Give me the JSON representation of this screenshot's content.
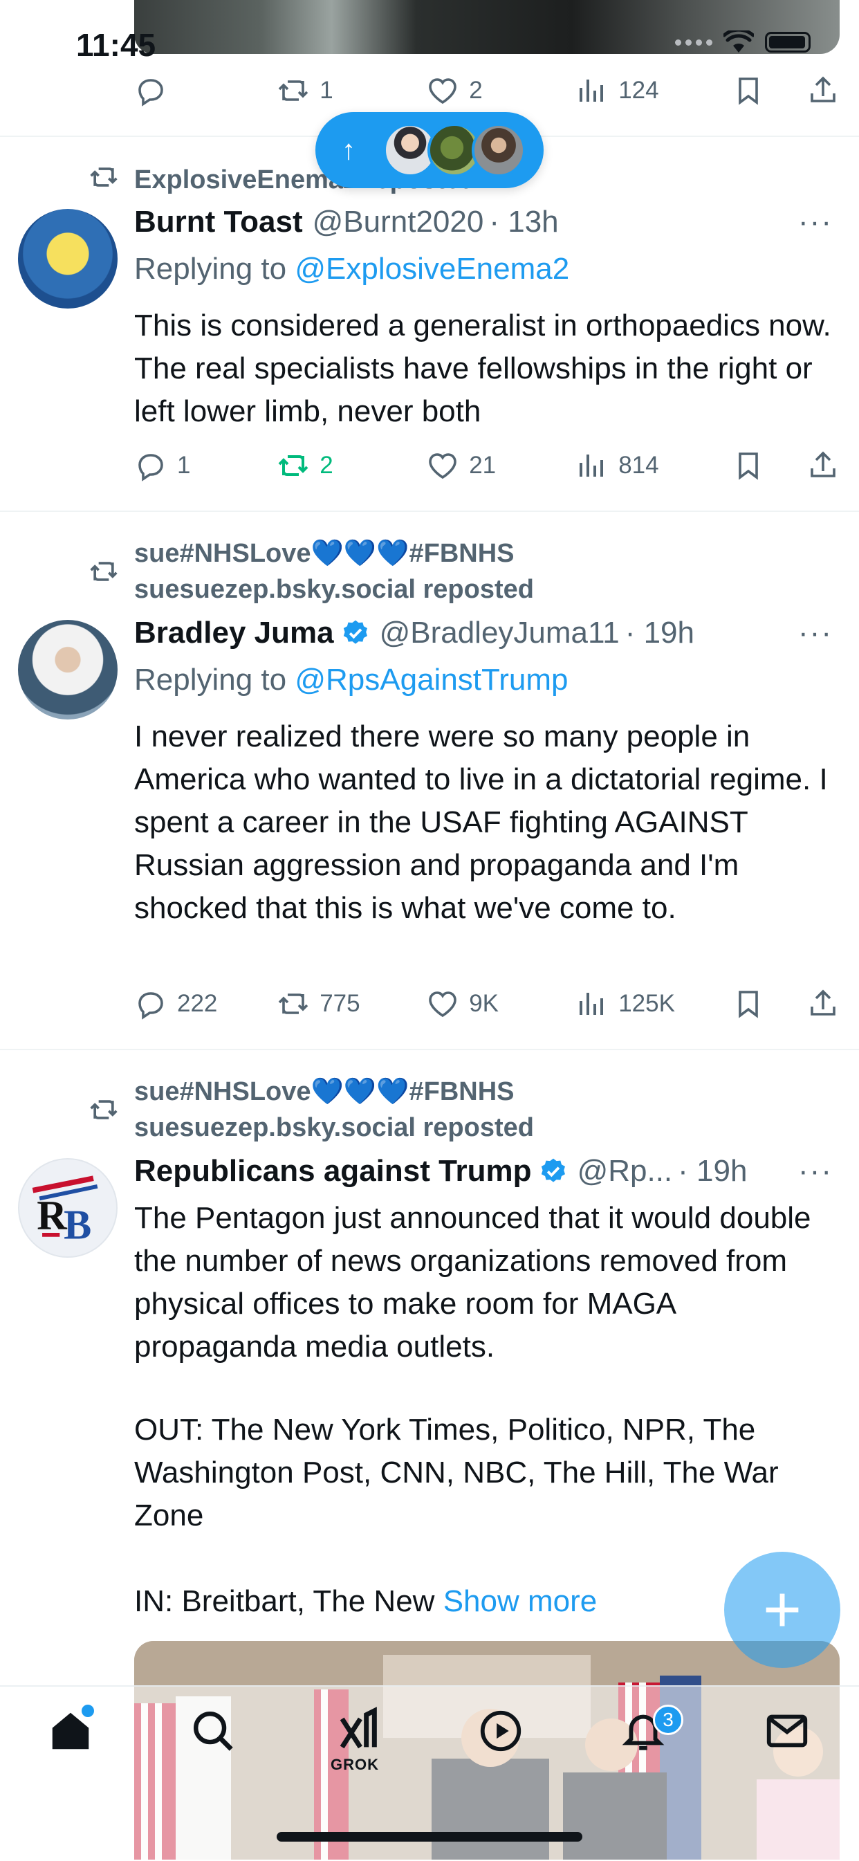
{
  "status_bar": {
    "time": "11:45"
  },
  "new_posts_pill": {
    "arrow": "↑"
  },
  "tweets": [
    {
      "actions": {
        "replies": "",
        "retweets": "1",
        "likes": "2",
        "views": "124"
      }
    },
    {
      "repost_by": "ExplosiveEnema2 reposted",
      "name": "Burnt Toast",
      "handle": "@Burnt2020",
      "time": "· 13h",
      "replying_label": "Replying to ",
      "replying_to": "@ExplosiveEnema2",
      "text": "This is considered a generalist in orthopaedics now. The real specialists have fellowships in the right or left lower limb, never both",
      "actions": {
        "replies": "1",
        "retweets": "2",
        "likes": "21",
        "views": "814"
      }
    },
    {
      "repost_by_line1_a": "sue#NHSLove",
      "repost_by_hearts": "💙💙💙",
      "repost_by_line1_b": "#FBNHS",
      "repost_by_line2": "suesuezep.bsky.social reposted",
      "name": "Bradley Juma",
      "handle": "@BradleyJuma11",
      "time": "· 19h",
      "replying_label": "Replying to ",
      "replying_to": "@RpsAgainstTrump",
      "text": "I never realized there were so many people in America who wanted to live in a dictatorial regime. I spent a career in the USAF fighting AGAINST Russian aggression and propaganda and I'm shocked that this is what we've come to.",
      "actions": {
        "replies": "222",
        "retweets": "775",
        "likes": "9K",
        "views": "125K"
      }
    },
    {
      "repost_by_line1_a": "sue#NHSLove",
      "repost_by_hearts": "💙💙💙",
      "repost_by_line1_b": "#FBNHS",
      "repost_by_line2": "suesuezep.bsky.social reposted",
      "name": "Republicans against Trump",
      "handle": "@Rp...",
      "time": "· 19h",
      "text_p1": "The Pentagon just announced that it would double the number of news organizations removed from physical offices to make room for MAGA propaganda media outlets.",
      "text_p2": "OUT: The New York Times, Politico, NPR, The Washington Post, CNN, NBC, The Hill, The War Zone",
      "text_p3": "IN: Breitbart, The New ",
      "show_more": "Show more"
    }
  ],
  "tab_bar": {
    "grok_label": "GROK",
    "notifications_badge": "3"
  },
  "colors": {
    "accent": "#1d9bf0",
    "retweet_active": "#00ba7c",
    "secondary_text": "#536471"
  },
  "icons": [
    "reply-icon",
    "retweet-icon",
    "like-icon",
    "views-icon",
    "bookmark-icon",
    "share-icon",
    "more-icon",
    "verified-icon",
    "home-icon",
    "search-icon",
    "grok-icon",
    "video-icon",
    "bell-icon",
    "mail-icon",
    "compose-icon"
  ]
}
